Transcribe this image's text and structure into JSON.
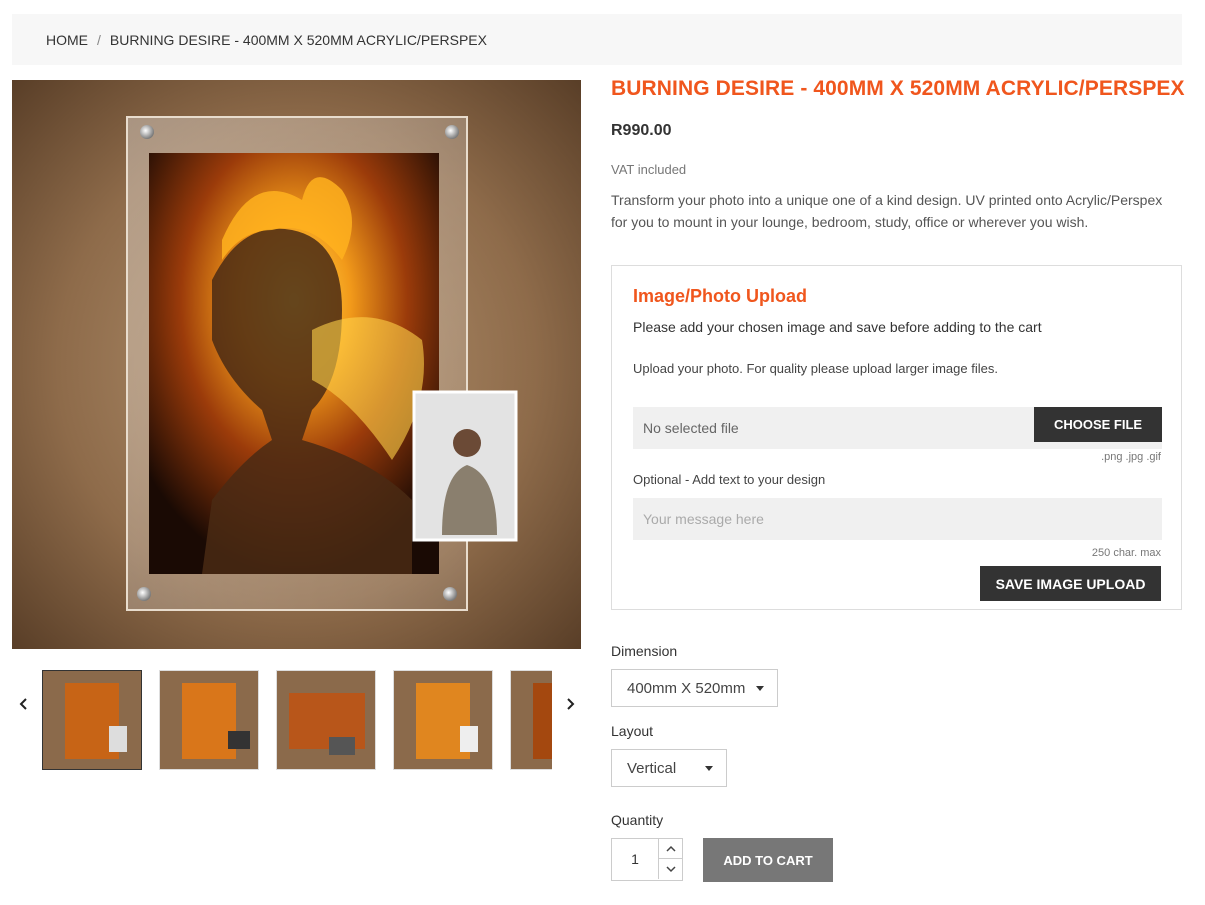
{
  "breadcrumb": {
    "home": "HOME",
    "separator": "/",
    "current": "BURNING DESIRE - 400MM X 520MM ACRYLIC/PERSPEX"
  },
  "product": {
    "title": "BURNING DESIRE - 400MM X 520MM ACRYLIC/PERSPEX",
    "price": "R990.00",
    "vat": "VAT included",
    "description": "Transform your photo into a unique one of a kind design. UV printed onto Acrylic/Perspex for you to mount in your lounge, bedroom, study, office or wherever you wish."
  },
  "upload": {
    "title": "Image/Photo Upload",
    "subtitle": "Please add your chosen image and save before adding to the cart",
    "hint": "Upload your photo. For quality please upload larger image files.",
    "file_status": "No selected file",
    "choose_label": "CHOOSE FILE",
    "file_types": ".png .jpg .gif",
    "optional_label": "Optional - Add text to your design",
    "message_placeholder": "Your message here",
    "char_max": "250 char. max",
    "save_label": "SAVE IMAGE UPLOAD"
  },
  "options": {
    "dimension_label": "Dimension",
    "dimension_value": "400mm X 520mm",
    "layout_label": "Layout",
    "layout_value": "Vertical",
    "quantity_label": "Quantity",
    "quantity_value": "1",
    "add_to_cart": "ADD TO CART"
  },
  "gallery": {
    "thumbnail_count": 5,
    "active_index": 0
  },
  "colors": {
    "accent": "#f0561d",
    "dark_button": "#333333",
    "disabled_button": "#777777"
  },
  "icons": {
    "prev": "chevron-left-icon",
    "next": "chevron-right-icon",
    "dropdown": "caret-down-icon",
    "stepper_up": "chevron-up-icon",
    "stepper_down": "chevron-down-icon"
  }
}
